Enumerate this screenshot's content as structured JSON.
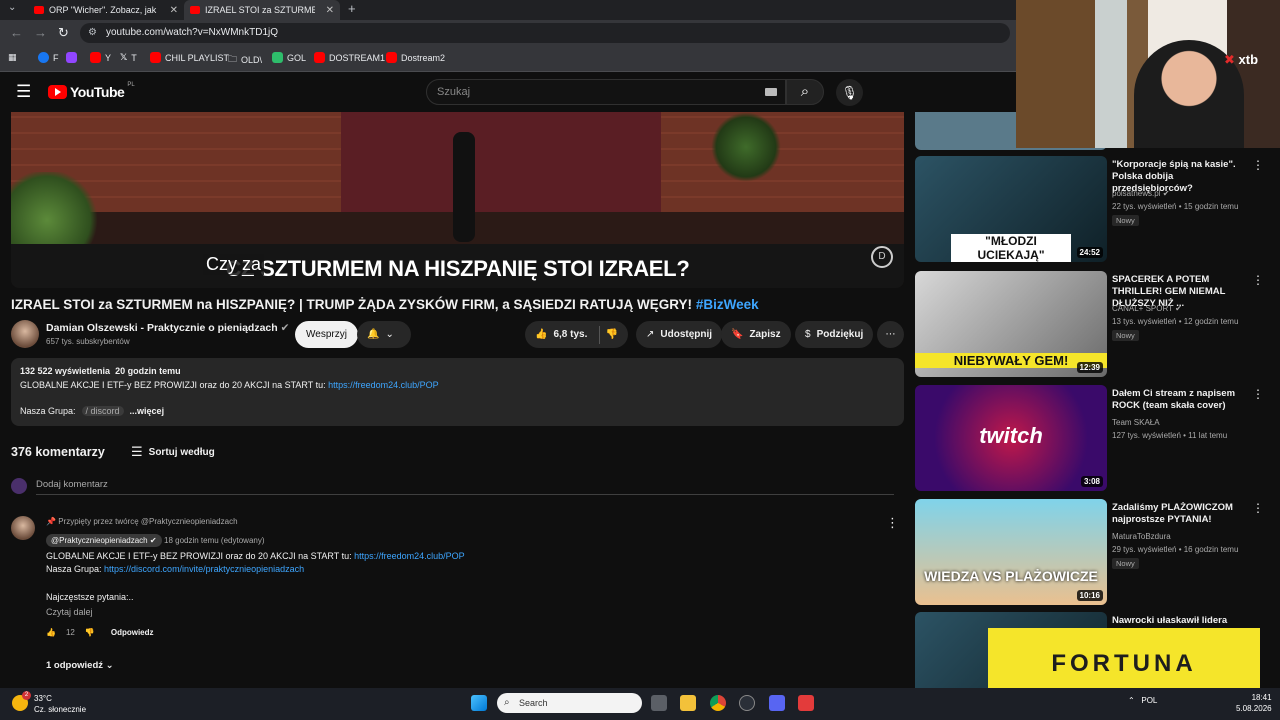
{
  "browser": {
    "tabs": [
      {
        "label": "ORP \"Wicher\". Zobacz, jak rośnie",
        "active": false
      },
      {
        "label": "IZRAEL STOI za SZTURMEM na",
        "active": true
      }
    ],
    "new_tab": "+",
    "url": "youtube.com/watch?v=NxWMnkTD1jQ",
    "bookmarks": [
      "F",
      "Y",
      "T",
      "CHIL PLAYLIST",
      "OLD\\",
      "GOL",
      "DOSTREAM1",
      "Dostream2"
    ]
  },
  "youtube": {
    "logo_text": "YouTube",
    "logo_region": "PL",
    "search_placeholder": "Szukaj"
  },
  "video": {
    "caption": "CZY STOI ZA SZTURMEM NA HISZPANIĘ STOI IZRAEL?",
    "caption_display": "CZ     SZTURMEM NA HISZPANIĘ STOI IZRAEL?",
    "caption_overlay": "Czy za",
    "title": "IZRAEL STOI za SZTURMEM na HISZPANIĘ? | TRUMP ŻĄDA ZYSKÓW FIRM, a SĄSIEDZI RATUJĄ WĘGRY!",
    "hashtag": "#BizWeek",
    "channel_name": "Damian Olszewski - Praktycznie o pieniądzach",
    "subscribers": "657 tys. subskrybentów",
    "support_label": "Wesprzyj",
    "likes": "6,8 tys.",
    "share_label": "Udostępnij",
    "save_label": "Zapisz",
    "thanks_label": "Podziękuj"
  },
  "description": {
    "views": "132 522 wyświetlenia",
    "age": "20 godzin temu",
    "line1_text": "GLOBALNE AKCJE I ETF-y BEZ PROWIZJI oraz do 20 AKCJI na START tu: ",
    "line1_link": "https://freedom24.club/POP",
    "group_label": "Nasza Grupa:",
    "group_link": "/ discord",
    "more": "...więcej"
  },
  "comments": {
    "count": "376 komentarzy",
    "sort_label": "Sortuj według",
    "add_placeholder": "Dodaj komentarz",
    "pinned": {
      "pinned_by": "Przypięty przez twórcę @Praktycznieopieniadzach",
      "author": "@Praktycznieopieniadzach",
      "time": "18 godzin temu (edytowany)",
      "line1_text": "GLOBALNE AKCJE I ETF-y BEZ PROWIZJI oraz do 20 AKCJI na START tu: ",
      "line1_link": "https://freedom24.club/POP",
      "line2_text": "Nasza Grupa: ",
      "line2_link": "https://discord.com/invite/praktycznieopieniadzach",
      "line3": "Najczęstsze pytania:..",
      "read_more": "Czytaj dalej",
      "likes": "12",
      "reply": "Odpowiedz",
      "replies": "1 odpowiedź"
    }
  },
  "recommendations": [
    {
      "title": "\"Korporacje śpią na kasie\". Polska dobija przedsiębiorców?",
      "channel": "polsatnews.pl",
      "stats": "22 tys. wyświetleń • 15 godzin temu",
      "badge": "Nowy",
      "duration": "24:52",
      "thumb_text": "\"MŁODZI UCIEKAJĄ\""
    },
    {
      "title": "SPACEREK A POTEM THRILLER! GEM NIEMAL DŁUŻSZY NIŻ ...",
      "channel": "CANAL+ SPORT",
      "stats": "13 tys. wyświetleń • 12 godzin temu",
      "badge": "Nowy",
      "duration": "12:39",
      "thumb_text": "NIEBYWAŁY GEM!"
    },
    {
      "title": "Dałem Ci stream z napisem ROCK (team skała cover)",
      "channel": "Team SKAŁA",
      "stats": "127 tys. wyświetleń • 11 lat temu",
      "badge": "",
      "duration": "3:08",
      "thumb_text": "twitch"
    },
    {
      "title": "Zadaliśmy PLAŻOWICZOM najprostsze PYTANIA!",
      "channel": "MaturaToBzdura",
      "stats": "29 tys. wyświetleń • 16 godzin temu",
      "badge": "Nowy",
      "duration": "10:16",
      "thumb_text": "WIEDZA VS PLAŻOWICZE"
    },
    {
      "title": "Nawrocki ułaskawił lidera",
      "channel": "",
      "stats": "",
      "badge": "",
      "duration": "",
      "thumb_text": ""
    }
  ],
  "overlays": {
    "xtb": "xtb",
    "fortuna": "FORTUNA"
  },
  "taskbar": {
    "temp": "33°C",
    "weather": "Cz. słonecznie",
    "weather_badge": "2",
    "search": "Search",
    "lang": "POL",
    "time": "18:41",
    "date": "5.08.2026"
  },
  "colors": {
    "youtube_red": "#ff0000",
    "link_blue": "#3ea6ff",
    "background": "#0f0f0f",
    "fortuna_yellow": "#f5e52a"
  }
}
